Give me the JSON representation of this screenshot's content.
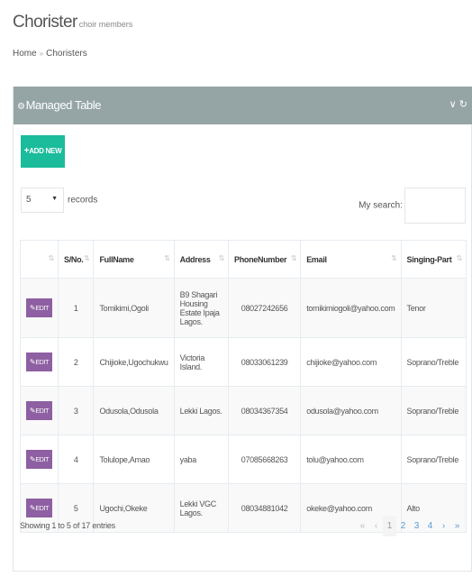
{
  "header": {
    "title": "Chorister",
    "subtitle": "choir members"
  },
  "breadcrumb": {
    "home": "Home",
    "separator": "»",
    "current": "Choristers"
  },
  "portlet": {
    "title": "Managed Table",
    "tools": "∨ ↻"
  },
  "toolbar": {
    "add_label": "ADD NEW"
  },
  "length_menu": {
    "value": "5",
    "records_label": "records"
  },
  "search": {
    "label": "My search:",
    "placeholder": ""
  },
  "table": {
    "columns": [
      "",
      "S/No.",
      "FullName",
      "Address",
      "PhoneNumber",
      "Email",
      "Singing-Part"
    ],
    "edit_label": "EDIT",
    "rows": [
      {
        "sno": "1",
        "name": "Tomikimi,Ogoli",
        "address": "B9 Shagari Housing Estate Ipaja Lagos.",
        "phone": "08027242656",
        "email": "tomikimiogoli@yahoo.com",
        "part": "Tenor"
      },
      {
        "sno": "2",
        "name": "Chijioke,Ugochukwu",
        "address": "Victoria Island.",
        "phone": "08033061239",
        "email": "chijioke@yahoo.com",
        "part": "Soprano/Treble"
      },
      {
        "sno": "3",
        "name": "Odusola,Odusola",
        "address": "Lekki Lagos.",
        "phone": "08034367354",
        "email": "odusola@yahoo.com",
        "part": "Soprano/Treble"
      },
      {
        "sno": "4",
        "name": "Tolulope,Amao",
        "address": "yaba",
        "phone": "07085668263",
        "email": "tolu@yahoo.com",
        "part": "Soprano/Treble"
      },
      {
        "sno": "5",
        "name": "Ugochi,Okeke",
        "address": "Lekki VGC Lagos.",
        "phone": "08034881042",
        "email": "okeke@yahoo.com",
        "part": "Alto"
      }
    ]
  },
  "footer": {
    "info": "Showing 1 to 5 of 17 entries"
  },
  "pagination": {
    "first": "«",
    "prev": "‹",
    "pages": [
      "1",
      "2",
      "3",
      "4"
    ],
    "next": "›",
    "last": "»"
  },
  "colors": {
    "bar": "#95a5a6",
    "add_button": "#1bbc9b",
    "edit_button": "#8e5fa2",
    "link": "#5c9bd1"
  }
}
